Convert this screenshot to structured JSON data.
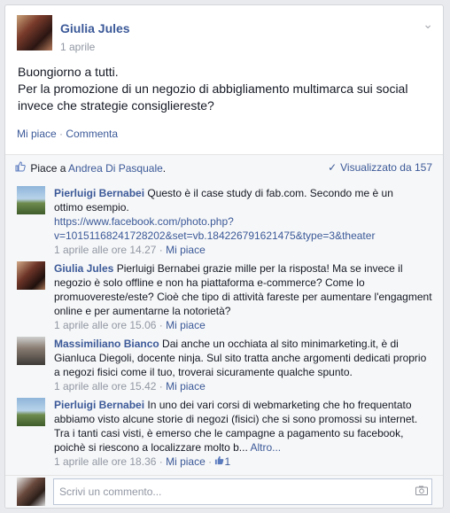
{
  "post": {
    "author": "Giulia Jules",
    "date": "1 aprile",
    "text_lines": [
      "Buongiorno a tutti.",
      "Per la promozione di un negozio di abbigliamento multimarca sui social",
      "invece che strategie consigliereste?"
    ],
    "actions": {
      "like": "Mi piace",
      "dot": " · ",
      "comment": "Commenta"
    }
  },
  "feedback": {
    "likes_prefix": "Piace a ",
    "likes_person": "Andrea Di Pasquale",
    "likes_suffix": ".",
    "seen": "Visualizzato da 157"
  },
  "comments": [
    {
      "author": "Pierluigi Bernabei",
      "lines": [
        "Questo è il case study di fab.com. Secondo me è un",
        "ottimo esempio."
      ],
      "url_lines": [
        "https://www.facebook.com/photo.php?",
        "v=10151168241728202&set=vb.184226791621475&type=3&theater"
      ],
      "time": "1 aprile alle ore 14.27",
      "like": "Mi piace"
    },
    {
      "author": "Giulia Jules",
      "lines": [
        "Pierluigi Bernabei grazie mille per la risposta! Ma se invece il",
        "negozio è solo offline e non ha piattaforma e-commerce? Come lo",
        "promuovereste/este? Cioè che tipo di attività fareste per aumentare l'engagment",
        "online e per aumentarne la notorietà?"
      ],
      "time": "1 aprile alle ore 15.06",
      "like": "Mi piace"
    },
    {
      "author": "Massimiliano Bianco",
      "lines": [
        "Dai anche un occhiata al sito minimarketing.it, è di",
        "Gianluca Diegoli, docente ninja. Sul sito tratta anche argomenti dedicati proprio",
        "a negozi fisici come il tuo, troverai sicuramente qualche spunto."
      ],
      "time": "1 aprile alle ore 15.42",
      "like": "Mi piace"
    },
    {
      "author": "Pierluigi Bernabei",
      "lines": [
        "In uno dei vari corsi di webmarketing che ho frequentato",
        "abbiamo visto alcune storie di negozi (fisici) che si sono promossi su internet.",
        "Tra i tanti casi visti, è emerso che le campagne a pagamento su facebook,",
        "poichè si riescono a localizzare molto b..."
      ],
      "more": "Altro...",
      "time": "1 aprile alle ore 18.36",
      "like": "Mi piace",
      "like_count": "1"
    }
  ],
  "composer": {
    "placeholder": "Scrivi un commento..."
  },
  "sep": " · ",
  "icons": {
    "chevron": "chevron-down-icon",
    "thumb": "thumbs-up-icon",
    "check": "check-icon",
    "camera": "camera-icon"
  }
}
